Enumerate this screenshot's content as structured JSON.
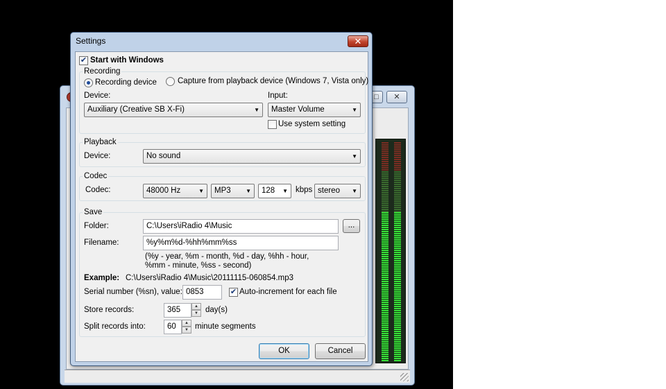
{
  "background_window": {
    "controls": [
      "□",
      "✕"
    ]
  },
  "dialog": {
    "title": "Settings",
    "close_glyph": "✕",
    "start_with_windows": {
      "label": "Start with Windows",
      "checked": true
    },
    "recording": {
      "group_label": "Recording",
      "radio_recording_device": "Recording device",
      "radio_capture_playback": "Capture from playback device (Windows 7, Vista only)",
      "selected": "Recording device",
      "device_label": "Device:",
      "device_value": "Auxiliary (Creative SB X-Fi)",
      "input_label": "Input:",
      "input_value": "Master Volume",
      "use_system_setting": {
        "label": "Use system setting",
        "checked": false
      }
    },
    "playback": {
      "group_label": "Playback",
      "device_label": "Device:",
      "device_value": "No sound"
    },
    "codec": {
      "group_label": "Codec",
      "codec_label": "Codec:",
      "sample_rate": "48000 Hz",
      "format": "MP3",
      "bitrate": "128",
      "bitrate_unit": "kbps",
      "channels": "stereo"
    },
    "save": {
      "group_label": "Save",
      "folder_label": "Folder:",
      "folder_value": "C:\\Users\\iRadio 4\\Music",
      "browse_label": "...",
      "filename_label": "Filename:",
      "filename_value": "%y%m%d-%hh%mm%ss",
      "help_line1": "(%y - year, %m - month, %d - day, %hh - hour,",
      "help_line2": "%mm - minute, %ss - second)",
      "example_label": "Example:",
      "example_value": "C:\\Users\\iRadio 4\\Music\\20111115-060854.mp3",
      "serial_label": "Serial number (%sn), value:",
      "serial_value": "0853",
      "auto_increment": {
        "label": "Auto-increment for each file",
        "checked": true
      },
      "store_label": "Store records:",
      "store_value": "365",
      "store_unit": "day(s)",
      "split_label": "Split records into:",
      "split_value": "60",
      "split_unit": "minute segments"
    },
    "ok_label": "OK",
    "cancel_label": "Cancel"
  },
  "vu_meter": {
    "left_level": 0.68,
    "right_level": 0.68
  },
  "icons": {
    "check": "✔",
    "dropdown": "▼",
    "spin_up": "▲",
    "spin_down": "▼"
  }
}
